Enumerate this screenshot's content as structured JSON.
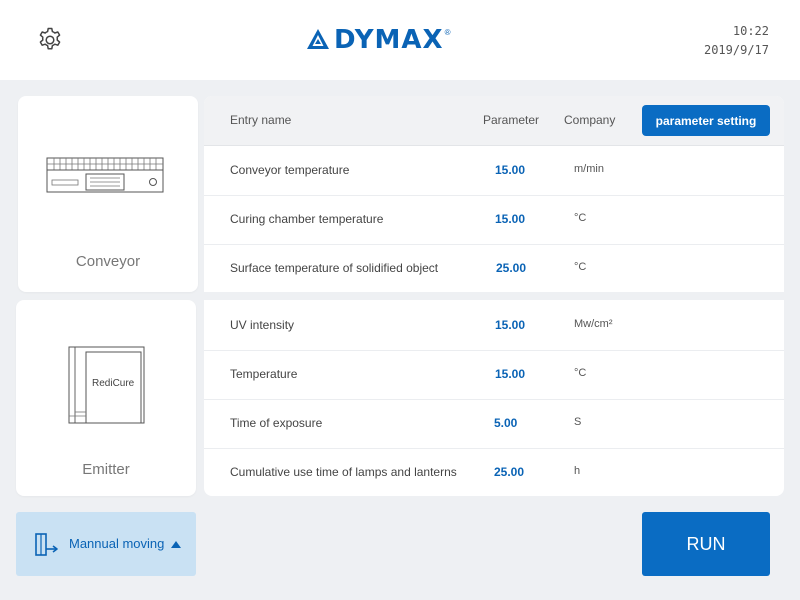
{
  "header": {
    "brand": "DYMAX",
    "registered_mark": "®",
    "time": "10:22",
    "date": "2019/9/17",
    "icons": {
      "settings": "gear-icon",
      "logo": "dymax-logo-icon"
    }
  },
  "sidebar": {
    "conveyor_label": "Conveyor",
    "emitter_label": "Emitter",
    "emitter_brand": "RediCure"
  },
  "table": {
    "headers": {
      "entry_name": "Entry name",
      "parameter": "Parameter",
      "company": "Company"
    },
    "parameter_setting_label": "parameter setting",
    "rows": [
      {
        "name": "Conveyor temperature",
        "value": "15.00",
        "unit": "m/min"
      },
      {
        "name": "Curing chamber temperature",
        "value": "15.00",
        "unit": "°C"
      },
      {
        "name": "Surface temperature of solidified object",
        "value": "25.00",
        "unit": "°C"
      },
      {
        "name": "UV intensity",
        "value": "15.00",
        "unit": "Mw/cm²"
      },
      {
        "name": "Temperature",
        "value": "15.00",
        "unit": "°C"
      },
      {
        "name": "Time of exposure",
        "value": "5.00",
        "unit": "S"
      },
      {
        "name": "Cumulative use time of lamps and lanterns",
        "value": "25.00",
        "unit": "h"
      }
    ]
  },
  "footer": {
    "manual_label": "Mannual moving",
    "run_label": "RUN"
  },
  "colors": {
    "accent": "#0a6cc3",
    "brand": "#0a63b5",
    "manual_bg": "#c9e1f3",
    "background": "#eef0f3"
  }
}
